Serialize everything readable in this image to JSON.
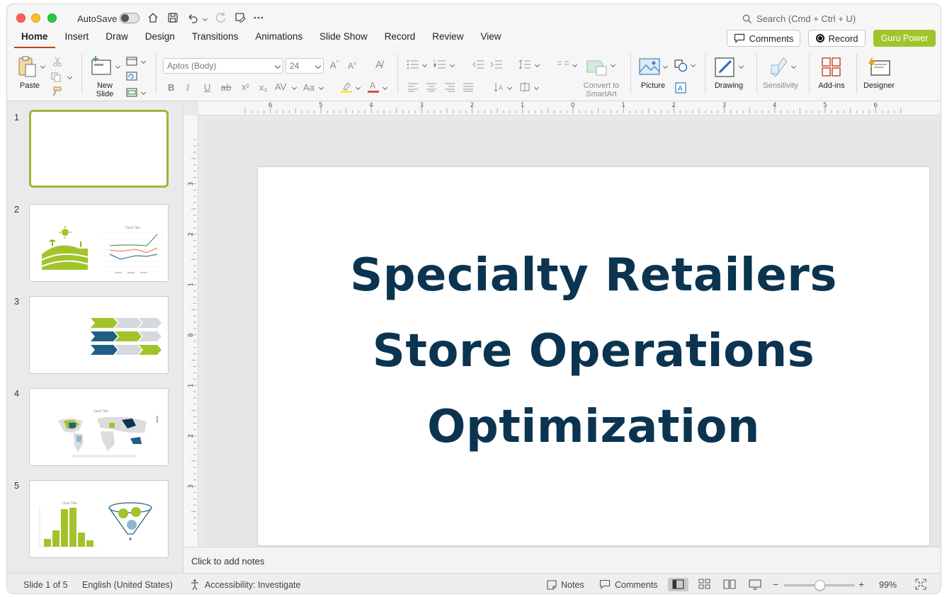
{
  "titlebar": {
    "autosave_label": "AutoSave",
    "search_placeholder": "Search (Cmd + Ctrl + U)"
  },
  "tabs": [
    {
      "label": "Home",
      "active": true
    },
    {
      "label": "Insert"
    },
    {
      "label": "Draw"
    },
    {
      "label": "Design"
    },
    {
      "label": "Transitions"
    },
    {
      "label": "Animations"
    },
    {
      "label": "Slide Show"
    },
    {
      "label": "Record"
    },
    {
      "label": "Review"
    },
    {
      "label": "View"
    }
  ],
  "actions": {
    "comments_label": "Comments",
    "record_label": "Record",
    "guru_label": "Guru Power",
    "guru_color": "#a2c42b"
  },
  "ribbon": {
    "paste_label": "Paste",
    "new_slide_label": "New Slide",
    "font_name": "Aptos (Body)",
    "font_size": "24",
    "smartart_label": "Convert to SmartArt",
    "picture_label": "Picture",
    "drawing_label": "Drawing",
    "sensitivity_label": "Sensitivity",
    "addins_label": "Add-ins",
    "designer_label": "Designer"
  },
  "ruler": {
    "top_numbers": [
      "6",
      "5",
      "4",
      "3",
      "2",
      "1",
      "0",
      "1",
      "2",
      "3",
      "4",
      "5",
      "6"
    ],
    "side_numbers": [
      "3",
      "2",
      "1",
      "0",
      "1",
      "2",
      "3"
    ]
  },
  "slides": [
    {
      "number": "1",
      "selected": true
    },
    {
      "number": "2"
    },
    {
      "number": "3"
    },
    {
      "number": "4"
    },
    {
      "number": "5"
    }
  ],
  "slide": {
    "title_lines": [
      "Specialty Retailers",
      "Store Operations",
      "Optimization"
    ],
    "title_color": "#0b3450"
  },
  "notes_placeholder": "Click to add notes",
  "status": {
    "slide_position": "Slide 1 of 5",
    "language": "English (United States)",
    "accessibility": "Accessibility: Investigate",
    "notes_label": "Notes",
    "comments_label": "Comments",
    "zoom": "99%",
    "zoom_fraction": 0.5
  },
  "colors": {
    "accent_green": "#a2c42b",
    "navy": "#0b3450",
    "teal": "#1f5f86",
    "active_tab_underline": "#c43e1c"
  }
}
